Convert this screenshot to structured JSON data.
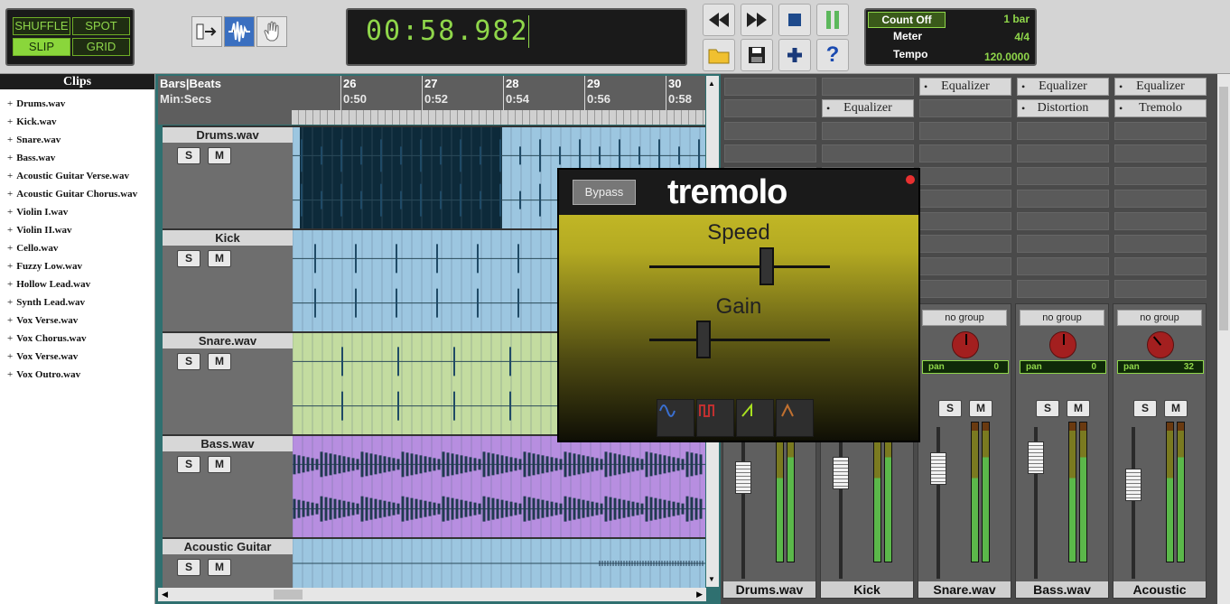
{
  "edit_modes": {
    "shuffle": "SHUFFLE",
    "spot": "SPOT",
    "slip": "SLIP",
    "grid": "GRID",
    "active": "SLIP"
  },
  "tools": [
    {
      "name": "trim-tool"
    },
    {
      "name": "selector-tool",
      "active": true
    },
    {
      "name": "grabber-tool"
    }
  ],
  "clock": {
    "time": "00:58.982"
  },
  "transport": {
    "rewind": "rewind",
    "forward": "fast-forward",
    "stop": "stop",
    "pause": "pause",
    "open": "open",
    "save": "save",
    "add": "add",
    "help": "?"
  },
  "meter_panel": {
    "count_off_label": "Count Off",
    "count_off_value": "1 bar",
    "meter_label": "Meter",
    "meter_value": "4/4",
    "tempo_label": "Tempo",
    "tempo_value": "120.0000"
  },
  "clips": {
    "title": "Clips",
    "items": [
      "Drums.wav",
      "Kick.wav",
      "Snare.wav",
      "Bass.wav",
      "Acoustic Guitar Verse.wav",
      "Acoustic Guitar Chorus.wav",
      "Violin I.wav",
      "Violin II.wav",
      "Cello.wav",
      "Fuzzy Low.wav",
      "Hollow Lead.wav",
      "Synth Lead.wav",
      "Vox Verse.wav",
      "Vox Chorus.wav",
      "Vox Verse.wav",
      "Vox Outro.wav"
    ]
  },
  "ruler": {
    "bars_label": "Bars|Beats",
    "time_label": "Min:Secs",
    "bars": [
      "26",
      "27",
      "28",
      "29",
      "30"
    ],
    "times": [
      "0:50",
      "0:52",
      "0:54",
      "0:56",
      "0:58"
    ]
  },
  "tracks": [
    {
      "name": "Drums.wav",
      "color": "#9cc6e0",
      "solo": "S",
      "mute": "M"
    },
    {
      "name": "Kick",
      "color": "#9cc6e0",
      "solo": "S",
      "mute": "M"
    },
    {
      "name": "Snare.wav",
      "color": "#c3dca0",
      "solo": "S",
      "mute": "M"
    },
    {
      "name": "Bass.wav",
      "color": "#b78ee0",
      "solo": "S",
      "mute": "M"
    },
    {
      "name": "Acoustic Guitar",
      "color": "#9cc6e0",
      "solo": "S",
      "mute": "M"
    }
  ],
  "inserts": {
    "equalizer": "Equalizer",
    "distortion": "Distortion",
    "tremolo": "Tremolo"
  },
  "strips": [
    {
      "name": "Drums.wav"
    },
    {
      "name": "Kick"
    },
    {
      "name": "Snare.wav",
      "group": "no group",
      "pan_label": "pan",
      "pan_value": "0",
      "solo": "S",
      "mute": "M"
    },
    {
      "name": "Bass.wav",
      "group": "no group",
      "pan_label": "pan",
      "pan_value": "0",
      "solo": "S",
      "mute": "M"
    },
    {
      "name": "Acoustic",
      "group": "no group",
      "pan_label": "pan",
      "pan_value": "32",
      "solo": "S",
      "mute": "M"
    }
  ],
  "tremolo": {
    "title": "tremolo",
    "bypass": "Bypass",
    "speed_label": "Speed",
    "gain_label": "Gain",
    "speed_value": 0.65,
    "gain_value": 0.3,
    "waveforms": [
      "sine",
      "square",
      "sawtooth",
      "triangle"
    ]
  },
  "colors": {
    "accent": "#8fd64a",
    "drums_selection": "#0d2a3a"
  }
}
